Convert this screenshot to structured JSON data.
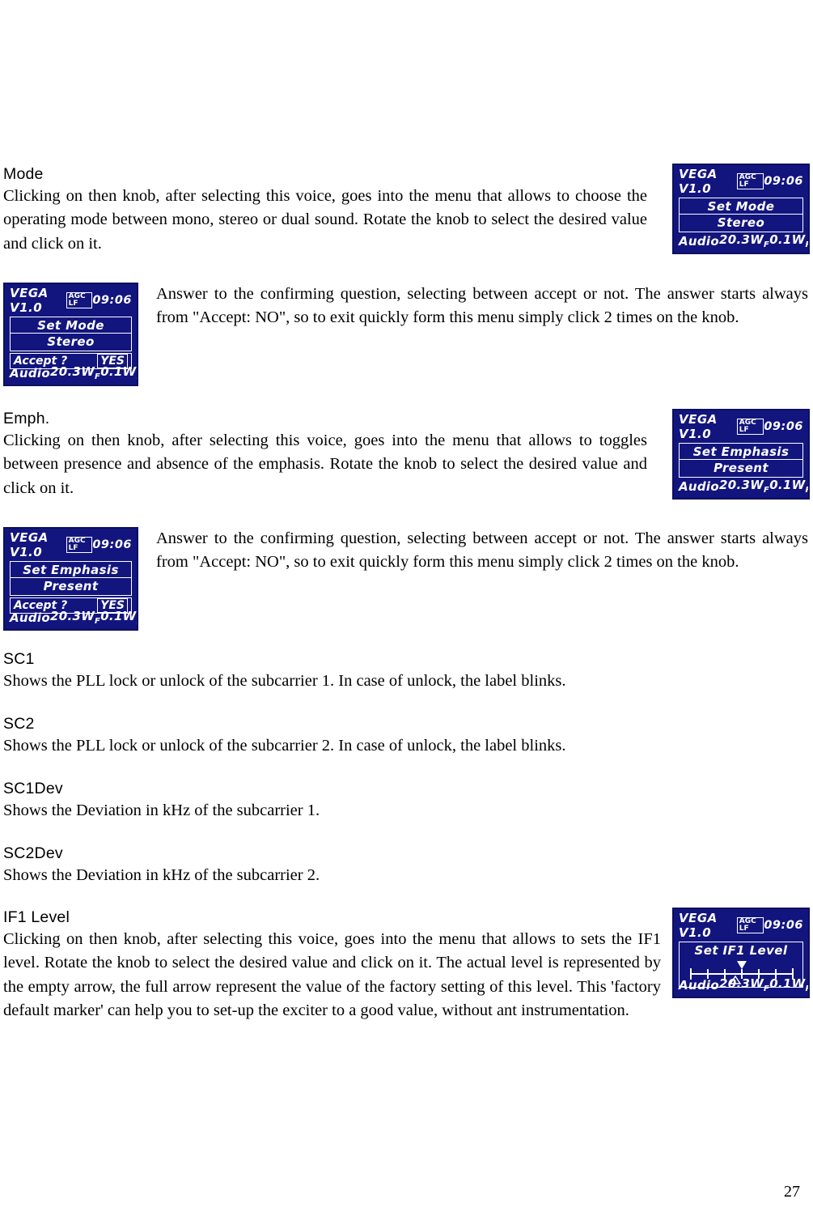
{
  "page": {
    "number": "27"
  },
  "sections": [
    {
      "heading": "Mode",
      "body": "Clicking on then knob, after selecting this voice, goes into the menu that allows to choose the operating mode between mono, stereo or dual sound. Rotate the knob to select the desired value and click on it."
    },
    {
      "heading": "",
      "body": "Answer to the confirming question, selecting between accept or not. The answer starts always from \"Accept: NO\", so to exit quickly form this menu simply click 2 times on the knob."
    },
    {
      "heading": "Emph.",
      "body": "Clicking on then knob, after selecting this voice, goes into the menu that allows to toggles between presence and absence of the emphasis. Rotate the knob to select the desired value and click on it."
    },
    {
      "heading": "",
      "body": "Answer to the confirming question, selecting between accept or not. The answer starts always from \"Accept: NO\", so to exit quickly form this menu simply click 2 times on the knob."
    },
    {
      "heading": "SC1",
      "body": "Shows the PLL lock or unlock of the subcarrier 1. In case of unlock, the label blinks."
    },
    {
      "heading": "SC2",
      "body": "Shows the PLL lock or unlock of the subcarrier 2. In case of unlock, the label blinks."
    },
    {
      "heading": "SC1Dev",
      "body": "Shows the Deviation in kHz of the subcarrier 1."
    },
    {
      "heading": "SC2Dev",
      "body": "Shows the Deviation in kHz of the subcarrier 2."
    },
    {
      "heading": "IF1 Level",
      "body": "Clicking on then knob, after selecting this voice, goes into the menu that allows to sets the IF1 level. Rotate the knob to select the desired value and click on it. The actual level is represented by the empty arrow, the full arrow represent the value of the factory setting of this level. This 'factory default marker' can help you to set-up the exciter to a good value, without ant instrumentation."
    }
  ],
  "displays": {
    "colors": {
      "screen_bg": "#13157e",
      "screen_border": "#0d0f5e",
      "screen_text": "#ffffff"
    },
    "common": {
      "brand": "VEGA  V1.0",
      "agc": "AGC  LF",
      "clock": "09:06",
      "audio_label": "Audio",
      "power_fwd": "20.3W",
      "power_fwd_sub": "F",
      "power_rfl": "0.1W",
      "power_rfl_sub": "R",
      "accept_label": "Accept  ?",
      "accept_value": "YES"
    },
    "mode": {
      "title": "Set  Mode",
      "value": "Stereo"
    },
    "mode_confirm": {
      "title": "Set  Mode",
      "value": "Stereo"
    },
    "emphasis": {
      "title": "Set  Emphasis",
      "value": "Present"
    },
    "emphasis_confirm": {
      "title": "Set  Emphasis",
      "value": "Present"
    },
    "if1level": {
      "title": "Set  IF1  Level"
    }
  }
}
